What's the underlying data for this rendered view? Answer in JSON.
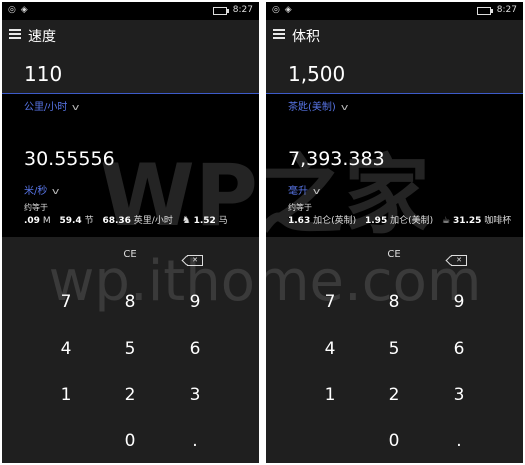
{
  "status": {
    "time": "8:27"
  },
  "left": {
    "title": "速度",
    "input_value": "110",
    "from_unit": "公里/小时",
    "result_value": "30.55556",
    "to_unit": "米/秒",
    "approx_label": "约等于",
    "approx": [
      {
        "num": ".09",
        "unit": "M"
      },
      {
        "num": "59.4",
        "unit": "节"
      },
      {
        "num": "68.36",
        "unit": "英里/小时"
      },
      {
        "num": "1.52",
        "unit": "马",
        "icon": "horse-icon"
      }
    ]
  },
  "right": {
    "title": "体积",
    "input_value": "1,500",
    "from_unit": "茶匙(美制)",
    "result_value": "7,393.383",
    "to_unit": "毫升",
    "approx_label": "约等于",
    "approx": [
      {
        "num": "1.63",
        "unit": "加仑(英制)"
      },
      {
        "num": "1.95",
        "unit": "加仑(美制)"
      },
      {
        "num": "31.25",
        "unit": "咖啡杯",
        "icon": "coffee-cup-icon"
      }
    ]
  },
  "keypad": {
    "ce": "CE",
    "k7": "7",
    "k8": "8",
    "k9": "9",
    "k4": "4",
    "k5": "5",
    "k6": "6",
    "k1": "1",
    "k2": "2",
    "k3": "3",
    "k0": "0",
    "dot": "."
  },
  "watermark": {
    "line1": "WP之家",
    "line2": "wp.ithome.com"
  }
}
